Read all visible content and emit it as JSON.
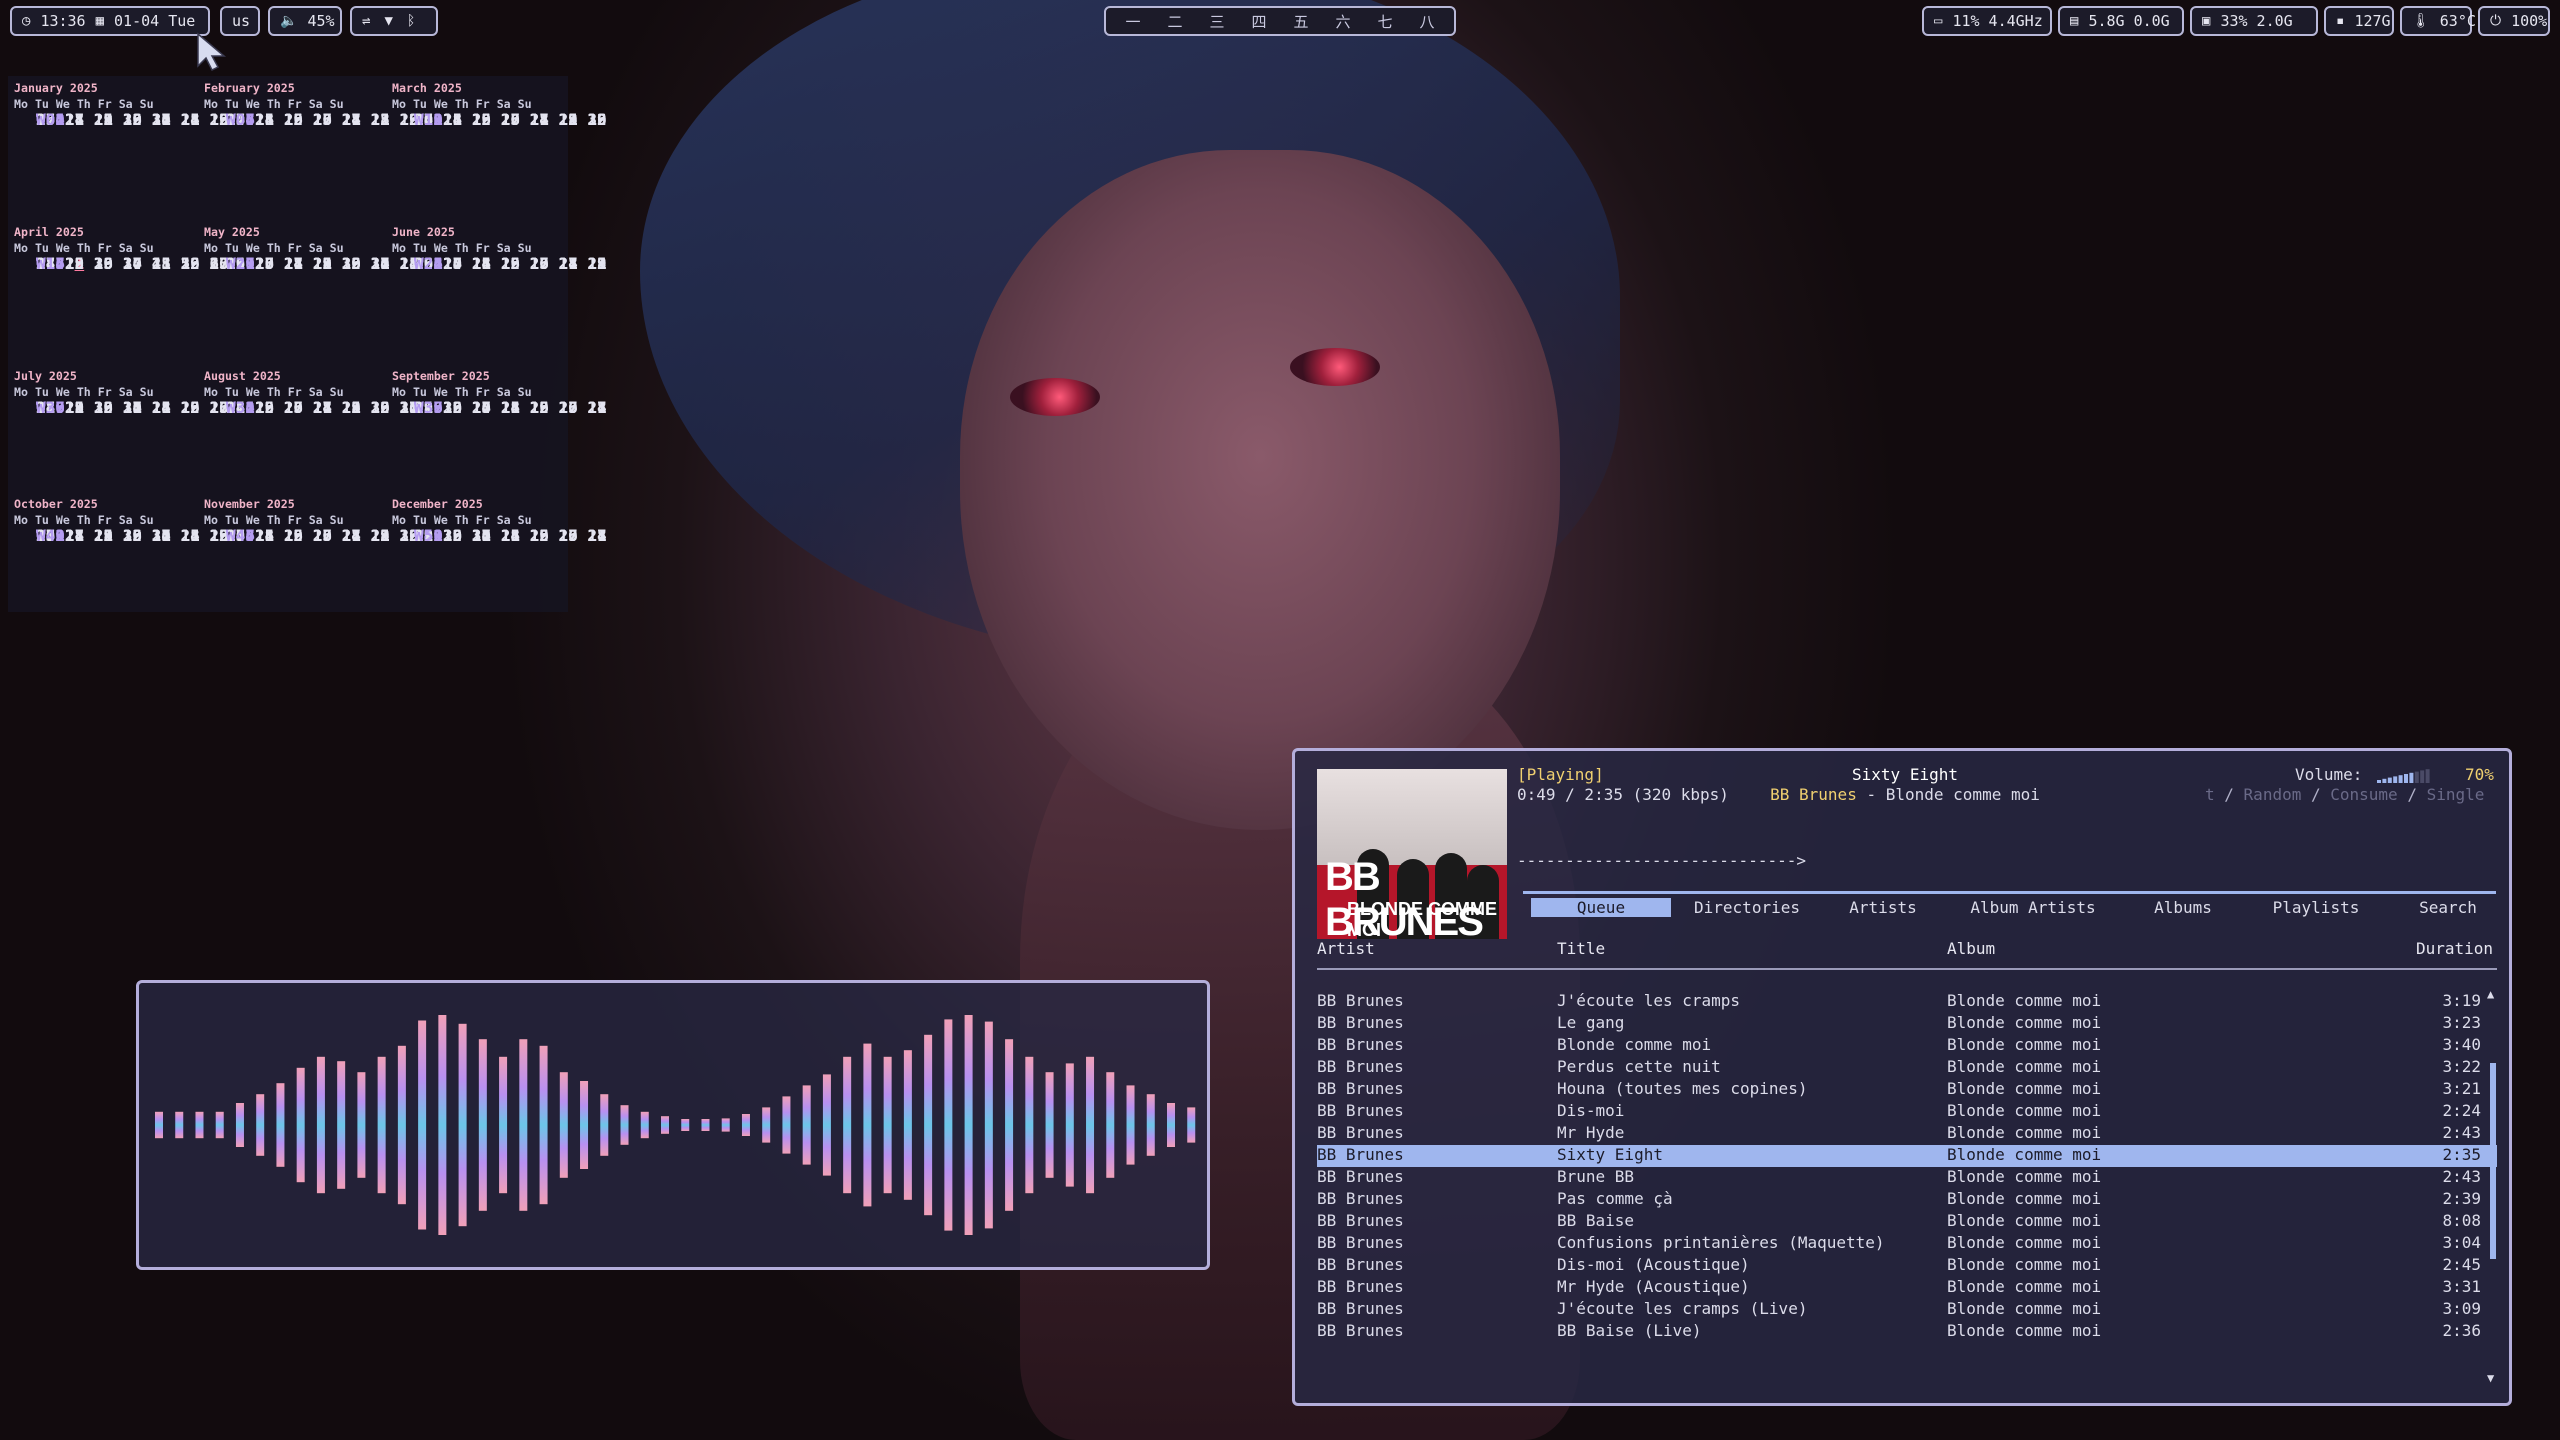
{
  "topbar": {
    "clock": "13:36",
    "date": "01-04 Tue",
    "keyboard": "us",
    "volume": "45%",
    "workspaces": [
      "一",
      "二",
      "三",
      "四",
      "五",
      "六",
      "七",
      "八"
    ],
    "cpu": "11% 4.4GHz",
    "memory": "5.8G 0.0G",
    "gpu": "33% 2.0G",
    "disk": "127G",
    "temp": "63°C",
    "battery": "100%"
  },
  "calendar": {
    "day_header": "Mo Tu We Th Fr Sa Su",
    "today": {
      "month": 3,
      "day": "1"
    },
    "months": [
      {
        "name": "January 2025",
        "rows": [
          [
            "       1  2  3  4  5 ",
            "W00"
          ],
          [
            " 6  7  8  9 10 11 12 ",
            "W01"
          ],
          [
            "13 14 15 16 17 18 19 ",
            "W02"
          ],
          [
            "20 21 22 23 24 25 26 ",
            "W03"
          ],
          [
            "27 28 29 30 31       ",
            "W04"
          ]
        ]
      },
      {
        "name": "February 2025",
        "rows": [
          [
            "                1  2 ",
            "W04"
          ],
          [
            " 3  4  5  6  7  8  9 ",
            "W05"
          ],
          [
            "10 11 12 13 14 15 16 ",
            "W06"
          ],
          [
            "17 18 19 20 21 22 23 ",
            "W07"
          ],
          [
            "24 25 26 27 28       ",
            "W08"
          ]
        ]
      },
      {
        "name": "March 2025",
        "rows": [
          [
            "                1  2 ",
            "W08"
          ],
          [
            " 3  4  5  6  7  8  9 ",
            "W09"
          ],
          [
            "10 11 12 13 14 15 16 ",
            "W10"
          ],
          [
            "17 18 19 20 21 22 23 ",
            "W11"
          ],
          [
            "24 25 26 27 28 29 30 ",
            "W12"
          ],
          [
            "31                   ",
            "W13"
          ]
        ]
      },
      {
        "name": "April 2025",
        "rows": [
          [
            "    1  2  3  4  5  6 ",
            "W13"
          ],
          [
            " 7  8  9 10 11 12 13 ",
            "W14"
          ],
          [
            "14 15 16 17 18 19 20 ",
            "W15"
          ],
          [
            "21 22 23 24 25 26 27 ",
            "W16"
          ],
          [
            "28 29 30             ",
            "W17"
          ]
        ]
      },
      {
        "name": "May 2025",
        "rows": [
          [
            "          1  2  3  4 ",
            "W17"
          ],
          [
            " 5  6  7  8  9 10 11 ",
            "W18"
          ],
          [
            "12 13 14 15 16 17 18 ",
            "W19"
          ],
          [
            "19 20 21 22 23 24 25 ",
            "W20"
          ],
          [
            "26 27 28 29 30 31    ",
            "W21"
          ]
        ]
      },
      {
        "name": "June 2025",
        "rows": [
          [
            "                   1 ",
            "W21"
          ],
          [
            " 2  3  4  5  6  7  8 ",
            "W22"
          ],
          [
            " 9 10 11 12 13 14 15 ",
            "W23"
          ],
          [
            "16 17 18 19 20 21 22 ",
            "W24"
          ],
          [
            "23 24 25 26 27 28 29 ",
            "W25"
          ],
          [
            "30                   ",
            "W26"
          ]
        ]
      },
      {
        "name": "July 2025",
        "rows": [
          [
            "    1  2  3  4  5  6 ",
            "W26"
          ],
          [
            " 7  8  9 10 11 12 13 ",
            "W27"
          ],
          [
            "14 15 16 17 18 19 20 ",
            "W28"
          ],
          [
            "21 22 23 24 25 26 27 ",
            "W29"
          ],
          [
            "28 29 30 31          ",
            "W30"
          ]
        ]
      },
      {
        "name": "August 2025",
        "rows": [
          [
            "             1  2  3 ",
            "W30"
          ],
          [
            " 4  5  6  7  8  9 10 ",
            "W31"
          ],
          [
            "11 12 13 14 15 16 17 ",
            "W32"
          ],
          [
            "18 19 20 21 22 23 24 ",
            "W33"
          ],
          [
            "25 26 27 28 29 30 31 ",
            "W34"
          ]
        ]
      },
      {
        "name": "September 2025",
        "rows": [
          [
            " 1  2  3  4  5  6  7 ",
            "W35"
          ],
          [
            " 8  9 10 11 12 13 14 ",
            "W36"
          ],
          [
            "15 16 17 18 19 20 21 ",
            "W37"
          ],
          [
            "22 23 24 25 26 27 28 ",
            "W38"
          ],
          [
            "29 30                ",
            "W39"
          ]
        ]
      },
      {
        "name": "October 2025",
        "rows": [
          [
            "       1  2  3  4  5 ",
            "W39"
          ],
          [
            " 6  7  8  9 10 11 12 ",
            "W40"
          ],
          [
            "13 14 15 16 17 18 19 ",
            "W41"
          ],
          [
            "20 21 22 23 24 25 26 ",
            "W42"
          ],
          [
            "27 28 29 30 31       ",
            "W43"
          ]
        ]
      },
      {
        "name": "November 2025",
        "rows": [
          [
            "                1  2 ",
            "W43"
          ],
          [
            " 3  4  5  6  7  8  9 ",
            "W44"
          ],
          [
            "10 11 12 13 14 15 16 ",
            "W45"
          ],
          [
            "17 18 19 20 21 22 23 ",
            "W46"
          ],
          [
            "24 25 26 27 28 29 30 ",
            "W47"
          ]
        ]
      },
      {
        "name": "December 2025",
        "rows": [
          [
            " 1  2  3  4  5  6  7 ",
            "W48"
          ],
          [
            " 8  9 10 11 12 13 14 ",
            "W49"
          ],
          [
            "15 16 17 18 19 20 21 ",
            "W50"
          ],
          [
            "22 23 24 25 26 27 28 ",
            "W51"
          ],
          [
            "29 30 31             ",
            "W52"
          ]
        ]
      }
    ]
  },
  "visualizer": {
    "bars": [
      0.12,
      0.12,
      0.12,
      0.12,
      0.2,
      0.28,
      0.38,
      0.52,
      0.62,
      0.58,
      0.48,
      0.62,
      0.72,
      0.95,
      1.0,
      0.92,
      0.78,
      0.62,
      0.78,
      0.72,
      0.48,
      0.4,
      0.28,
      0.18,
      0.12,
      0.08,
      0.04,
      0.04,
      0.06,
      0.1,
      0.16,
      0.26,
      0.36,
      0.46,
      0.62,
      0.74,
      0.62,
      0.68,
      0.82,
      0.96,
      1.0,
      0.94,
      0.78,
      0.62,
      0.48,
      0.56,
      0.62,
      0.48,
      0.36,
      0.28,
      0.2,
      0.16,
      0.14,
      0.12
    ],
    "colors": [
      "#6cc6e8",
      "#b890f0",
      "#f0a0b8"
    ]
  },
  "player": {
    "cover": {
      "line1": "BB BRUNES",
      "line2": "BLONDE COMME MOI"
    },
    "state": "[Playing]",
    "time": "0:49 / 2:35 (320 kbps)",
    "title": "Sixty Eight",
    "artist": "BB Brunes",
    "sep": " - ",
    "album": "Blonde comme moi",
    "volume_label": "Volume:",
    "volume_value": "70%",
    "volume_level": 0.7,
    "modes": [
      "t",
      "Random",
      "Consume",
      "Single"
    ],
    "progress_text": "----------------------------->",
    "progress": 0.32,
    "tabs": [
      "Queue",
      "Directories",
      "Artists",
      "Album Artists",
      "Albums",
      "Playlists",
      "Search"
    ],
    "active_tab": "Queue",
    "columns": [
      "Artist",
      "Title",
      "Album",
      "Duration"
    ],
    "tracks": [
      [
        "BB Brunes",
        "J'écoute les cramps",
        "Blonde comme moi",
        "3:19"
      ],
      [
        "BB Brunes",
        "Le gang",
        "Blonde comme moi",
        "3:23"
      ],
      [
        "BB Brunes",
        "Blonde comme moi",
        "Blonde comme moi",
        "3:40"
      ],
      [
        "BB Brunes",
        "Perdus cette nuit",
        "Blonde comme moi",
        "3:22"
      ],
      [
        "BB Brunes",
        "Houna (toutes mes copines)",
        "Blonde comme moi",
        "3:21"
      ],
      [
        "BB Brunes",
        "Dis-moi",
        "Blonde comme moi",
        "2:24"
      ],
      [
        "BB Brunes",
        "Mr Hyde",
        "Blonde comme moi",
        "2:43"
      ],
      [
        "BB Brunes",
        "Sixty Eight",
        "Blonde comme moi",
        "2:35"
      ],
      [
        "BB Brunes",
        "Brune BB",
        "Blonde comme moi",
        "2:43"
      ],
      [
        "BB Brunes",
        "Pas comme çà",
        "Blonde comme moi",
        "2:39"
      ],
      [
        "BB Brunes",
        "BB Baise",
        "Blonde comme moi",
        "8:08"
      ],
      [
        "BB Brunes",
        "Confusions printanières (Maquette)",
        "Blonde comme moi",
        "3:04"
      ],
      [
        "BB Brunes",
        "Dis-moi (Acoustique)",
        "Blonde comme moi",
        "2:45"
      ],
      [
        "BB Brunes",
        "Mr Hyde (Acoustique)",
        "Blonde comme moi",
        "3:31"
      ],
      [
        "BB Brunes",
        "J'écoute les cramps (Live)",
        "Blonde comme moi",
        "3:09"
      ],
      [
        "BB Brunes",
        "BB Baise (Live)",
        "Blonde comme moi",
        "2:36"
      ]
    ],
    "selected_index": 7
  }
}
